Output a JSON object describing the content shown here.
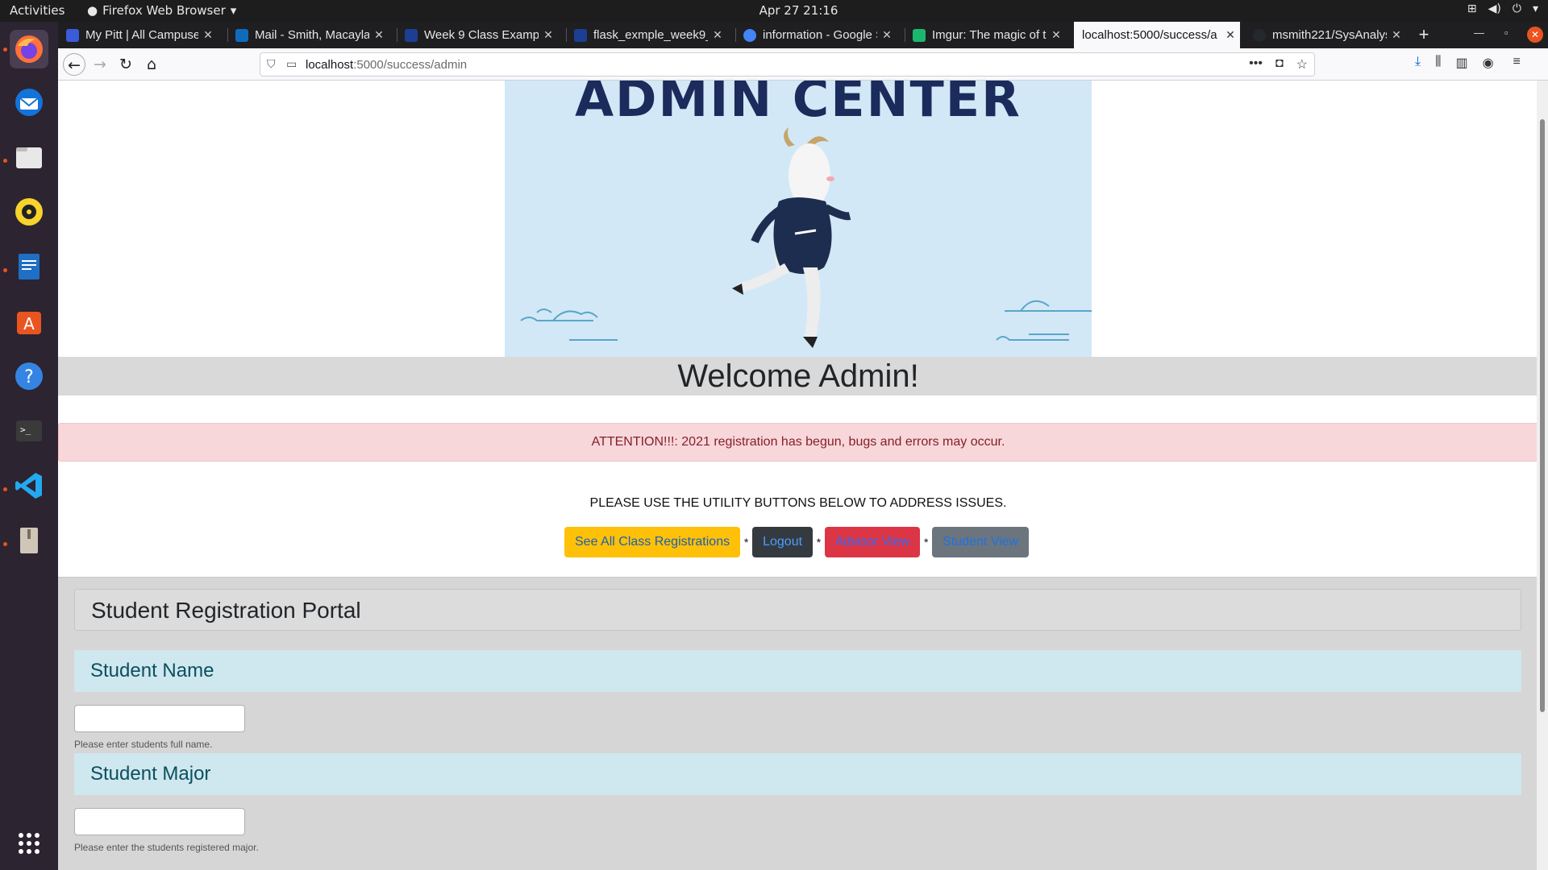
{
  "system": {
    "activities": "Activities",
    "app_menu": "Firefox Web Browser",
    "clock": "Apr 27  21:16"
  },
  "tabs": [
    {
      "title": "My Pitt | All Campuses",
      "color": "#3b5bdb"
    },
    {
      "title": "Mail - Smith, Macayla F",
      "color": "#0f6cbd"
    },
    {
      "title": "Week 9 Class Example",
      "color": "#1c3f94"
    },
    {
      "title": "flask_exmple_week9_",
      "color": "#1c3f94"
    },
    {
      "title": "information - Google S",
      "color": "#4285f4"
    },
    {
      "title": "Imgur: The magic of th",
      "color": "#1bb76e"
    },
    {
      "title": "localhost:5000/success/a",
      "color": "#cccccc"
    },
    {
      "title": "msmith221/SysAnalysi",
      "color": "#24292e"
    }
  ],
  "urlbar": {
    "host": "localhost",
    "path": ":5000/success/admin"
  },
  "page": {
    "banner_title": "ADMIN CENTER",
    "welcome": "Welcome Admin!",
    "alert": "ATTENTION!!!: 2021 registration has begun, bugs and errors may occur.",
    "instructions": "PLEASE USE THE UTILITY BUTTONS BELOW TO ADDRESS ISSUES.",
    "buttons": {
      "see_all": "See All Class Registrations",
      "logout": "Logout",
      "advisor": "Advisor View",
      "student": "Student View",
      "separator": "*"
    },
    "portal": {
      "title": "Student Registration Portal",
      "name_label": "Student Name",
      "name_value": "",
      "name_help": "Please enter students full name.",
      "major_label": "Student Major",
      "major_value": "",
      "major_help": "Please enter the students registered major."
    }
  }
}
